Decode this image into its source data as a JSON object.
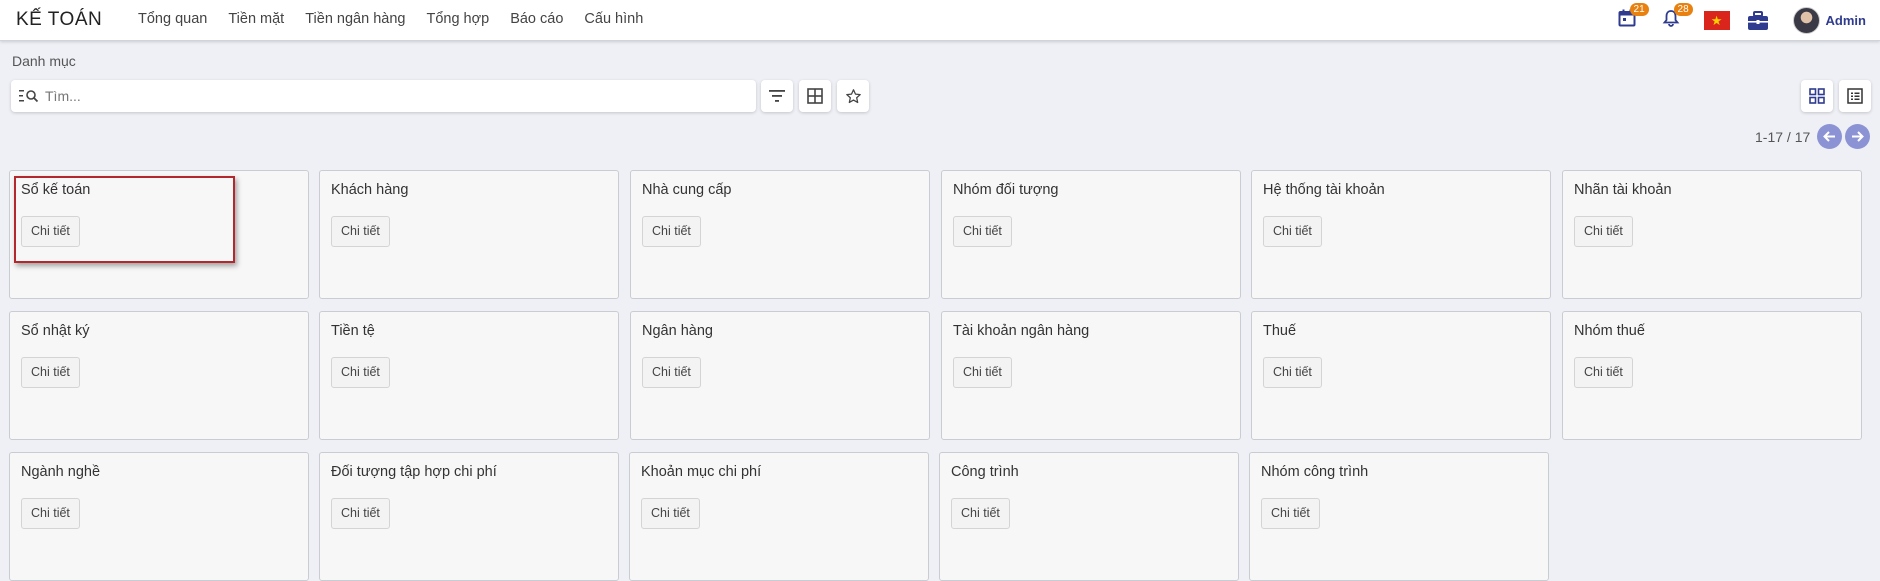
{
  "app": {
    "brand": "KẾ TOÁN",
    "menu": [
      "Tổng quan",
      "Tiền mặt",
      "Tiền ngân hàng",
      "Tổng hợp",
      "Báo cáo",
      "Cấu hình"
    ]
  },
  "systray": {
    "activities_count": "21",
    "notifications_count": "28",
    "user_name": "Admin"
  },
  "control_panel": {
    "breadcrumb": "Danh mục",
    "search_placeholder": "Tìm...",
    "pager": "1-17 / 17"
  },
  "cards": [
    {
      "title": "Sổ kế toán",
      "button": "Chi tiết"
    },
    {
      "title": "Khách hàng",
      "button": "Chi tiết"
    },
    {
      "title": "Nhà cung cấp",
      "button": "Chi tiết"
    },
    {
      "title": "Nhóm đối tượng",
      "button": "Chi tiết"
    },
    {
      "title": "Hệ thống tài khoản",
      "button": "Chi tiết"
    },
    {
      "title": "Nhãn tài khoản",
      "button": "Chi tiết"
    },
    {
      "title": "Sổ nhật ký",
      "button": "Chi tiết"
    },
    {
      "title": "Tiền tệ",
      "button": "Chi tiết"
    },
    {
      "title": "Ngân hàng",
      "button": "Chi tiết"
    },
    {
      "title": "Tài khoản ngân hàng",
      "button": "Chi tiết"
    },
    {
      "title": "Thuế",
      "button": "Chi tiết"
    },
    {
      "title": "Nhóm thuế",
      "button": "Chi tiết"
    },
    {
      "title": "Ngành nghề",
      "button": "Chi tiết"
    },
    {
      "title": "Đối tượng tập hợp chi phí",
      "button": "Chi tiết"
    },
    {
      "title": "Khoản mục chi phí",
      "button": "Chi tiết"
    },
    {
      "title": "Công trình",
      "button": "Chi tiết"
    },
    {
      "title": "Nhóm công trình",
      "button": "Chi tiết"
    }
  ],
  "colors": {
    "accent": "#2f3b8f",
    "badge": "#e8810f",
    "pager": "#8b93d4",
    "highlight": "#b3282d"
  }
}
